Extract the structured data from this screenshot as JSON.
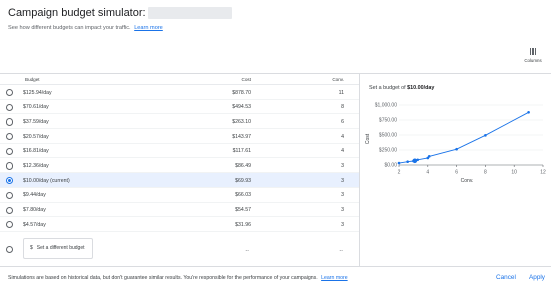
{
  "header": {
    "title": "Campaign budget simulator:",
    "subtitle": "See how different budgets can impact your traffic.",
    "learn_more": "Learn more"
  },
  "toolbar": {
    "columns_label": "Columns",
    "columns_icon": "columns-icon"
  },
  "table": {
    "headers": {
      "budget": "Budget",
      "cost": "Cost",
      "conv": "Conv."
    },
    "rows": [
      {
        "budget": "$125.94/day",
        "cost": "$878.70",
        "conv": "11",
        "selected": false
      },
      {
        "budget": "$70.61/day",
        "cost": "$494.53",
        "conv": "8",
        "selected": false
      },
      {
        "budget": "$37.59/day",
        "cost": "$263.10",
        "conv": "6",
        "selected": false
      },
      {
        "budget": "$20.57/day",
        "cost": "$143.97",
        "conv": "4",
        "selected": false
      },
      {
        "budget": "$16.81/day",
        "cost": "$117.61",
        "conv": "4",
        "selected": false
      },
      {
        "budget": "$12.36/day",
        "cost": "$86.49",
        "conv": "3",
        "selected": false
      },
      {
        "budget": "$10.00/day (current)",
        "cost": "$69.93",
        "conv": "3",
        "selected": true
      },
      {
        "budget": "$9.44/day",
        "cost": "$66.03",
        "conv": "3",
        "selected": false
      },
      {
        "budget": "$7.80/day",
        "cost": "$54.57",
        "conv": "3",
        "selected": false
      },
      {
        "budget": "$4.57/day",
        "cost": "$31.96",
        "conv": "3",
        "selected": false
      }
    ],
    "different_budget": {
      "currency": "$",
      "placeholder": "Set a different budget",
      "cost": "--",
      "conv": "--"
    }
  },
  "chart_caption": {
    "prefix": "Set a budget of ",
    "value": "$10.00/day"
  },
  "chart_data": {
    "type": "line",
    "xlabel": "Conv.",
    "ylabel": "Cost",
    "xlim": [
      2,
      12
    ],
    "ylim": [
      0,
      1000
    ],
    "xticks": [
      "2",
      "4",
      "6",
      "8",
      "10",
      "12"
    ],
    "yticks": [
      "$0.00",
      "$250.00",
      "$500.00",
      "$750.00",
      "$1,000.00"
    ],
    "series": [
      {
        "values": [
          {
            "x": 2.0,
            "y": 31.96
          },
          {
            "x": 2.6,
            "y": 54.57
          },
          {
            "x": 3.0,
            "y": 66.03
          },
          {
            "x": 3.1,
            "y": 69.93
          },
          {
            "x": 3.3,
            "y": 86.49
          },
          {
            "x": 4.0,
            "y": 117.61
          },
          {
            "x": 4.1,
            "y": 143.97
          },
          {
            "x": 6.0,
            "y": 263.1
          },
          {
            "x": 8.0,
            "y": 494.53
          },
          {
            "x": 11.0,
            "y": 878.7
          }
        ]
      }
    ],
    "highlight_index": 3,
    "line_color": "#1a73e8",
    "grid": true
  },
  "footer": {
    "note": "Simulations are based on historical data, but don't guarantee similar results. You're responsible for the performance of your campaigns.",
    "learn_more": "Learn more",
    "cancel": "Cancel",
    "apply": "Apply"
  },
  "colors": {
    "accent": "#1a73e8",
    "selected_row": "#e8f0fe"
  }
}
